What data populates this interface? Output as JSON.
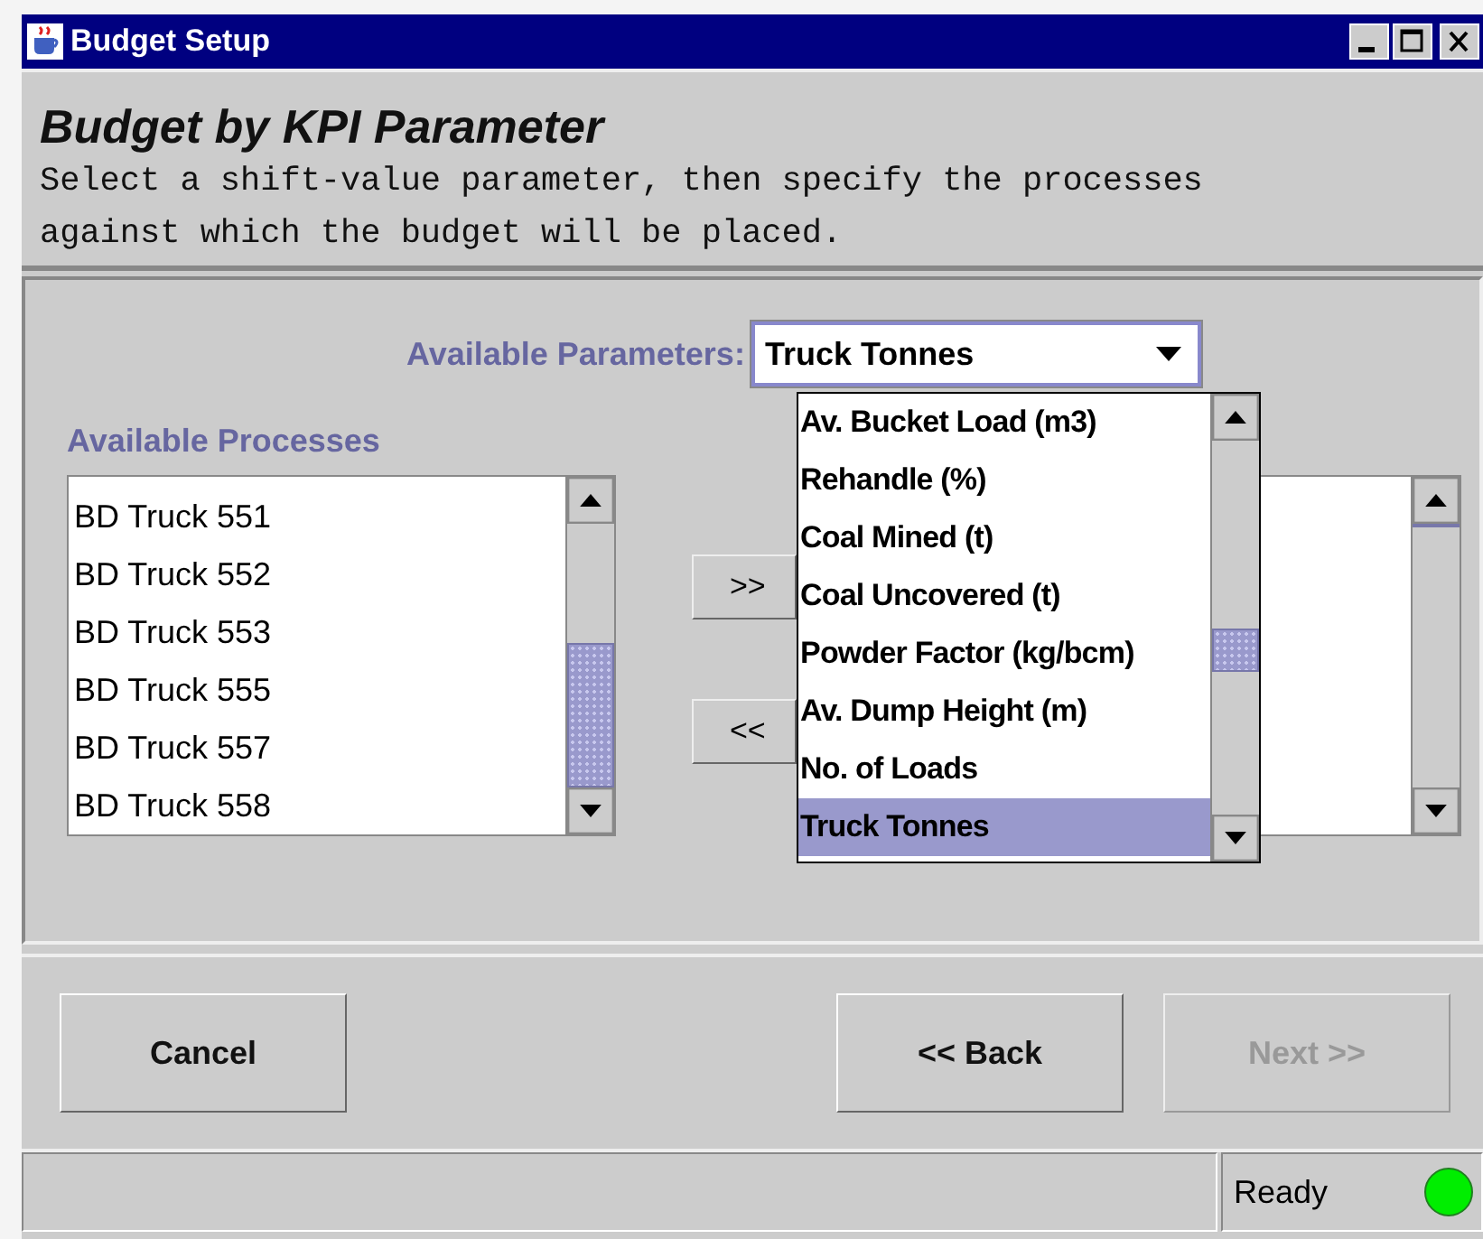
{
  "window": {
    "title": "Budget Setup"
  },
  "header": {
    "title": "Budget by KPI Parameter",
    "description": "Select a shift-value parameter, then specify the processes against which the budget will be placed."
  },
  "parameters": {
    "label": "Available Parameters:",
    "value": "Truck Tonnes",
    "expanded": true,
    "options": [
      {
        "label": "Av. Bucket Load (m3)",
        "selected": false
      },
      {
        "label": "Rehandle (%)",
        "selected": false
      },
      {
        "label": "Coal Mined (t)",
        "selected": false
      },
      {
        "label": "Coal Uncovered (t)",
        "selected": false
      },
      {
        "label": "Powder Factor (kg/bcm)",
        "selected": false
      },
      {
        "label": "Av. Dump Height (m)",
        "selected": false
      },
      {
        "label": "No. of Loads",
        "selected": false
      },
      {
        "label": "Truck Tonnes",
        "selected": true
      }
    ]
  },
  "processes": {
    "label": "Available Processes",
    "items": [
      "BD Truck 551",
      "BD Truck 552",
      "BD Truck 553",
      "BD Truck 555",
      "BD Truck 557",
      "BD Truck 558"
    ]
  },
  "transfer_buttons": [
    ">>",
    "<<"
  ],
  "buttons": [
    {
      "label": "Cancel",
      "disabled": false
    },
    {
      "label": "<< Back",
      "disabled": false
    },
    {
      "label": "Next >>",
      "disabled": true
    }
  ],
  "status_bar": {
    "text": "Ready",
    "indicator": {
      "color": "#00ee00"
    }
  }
}
